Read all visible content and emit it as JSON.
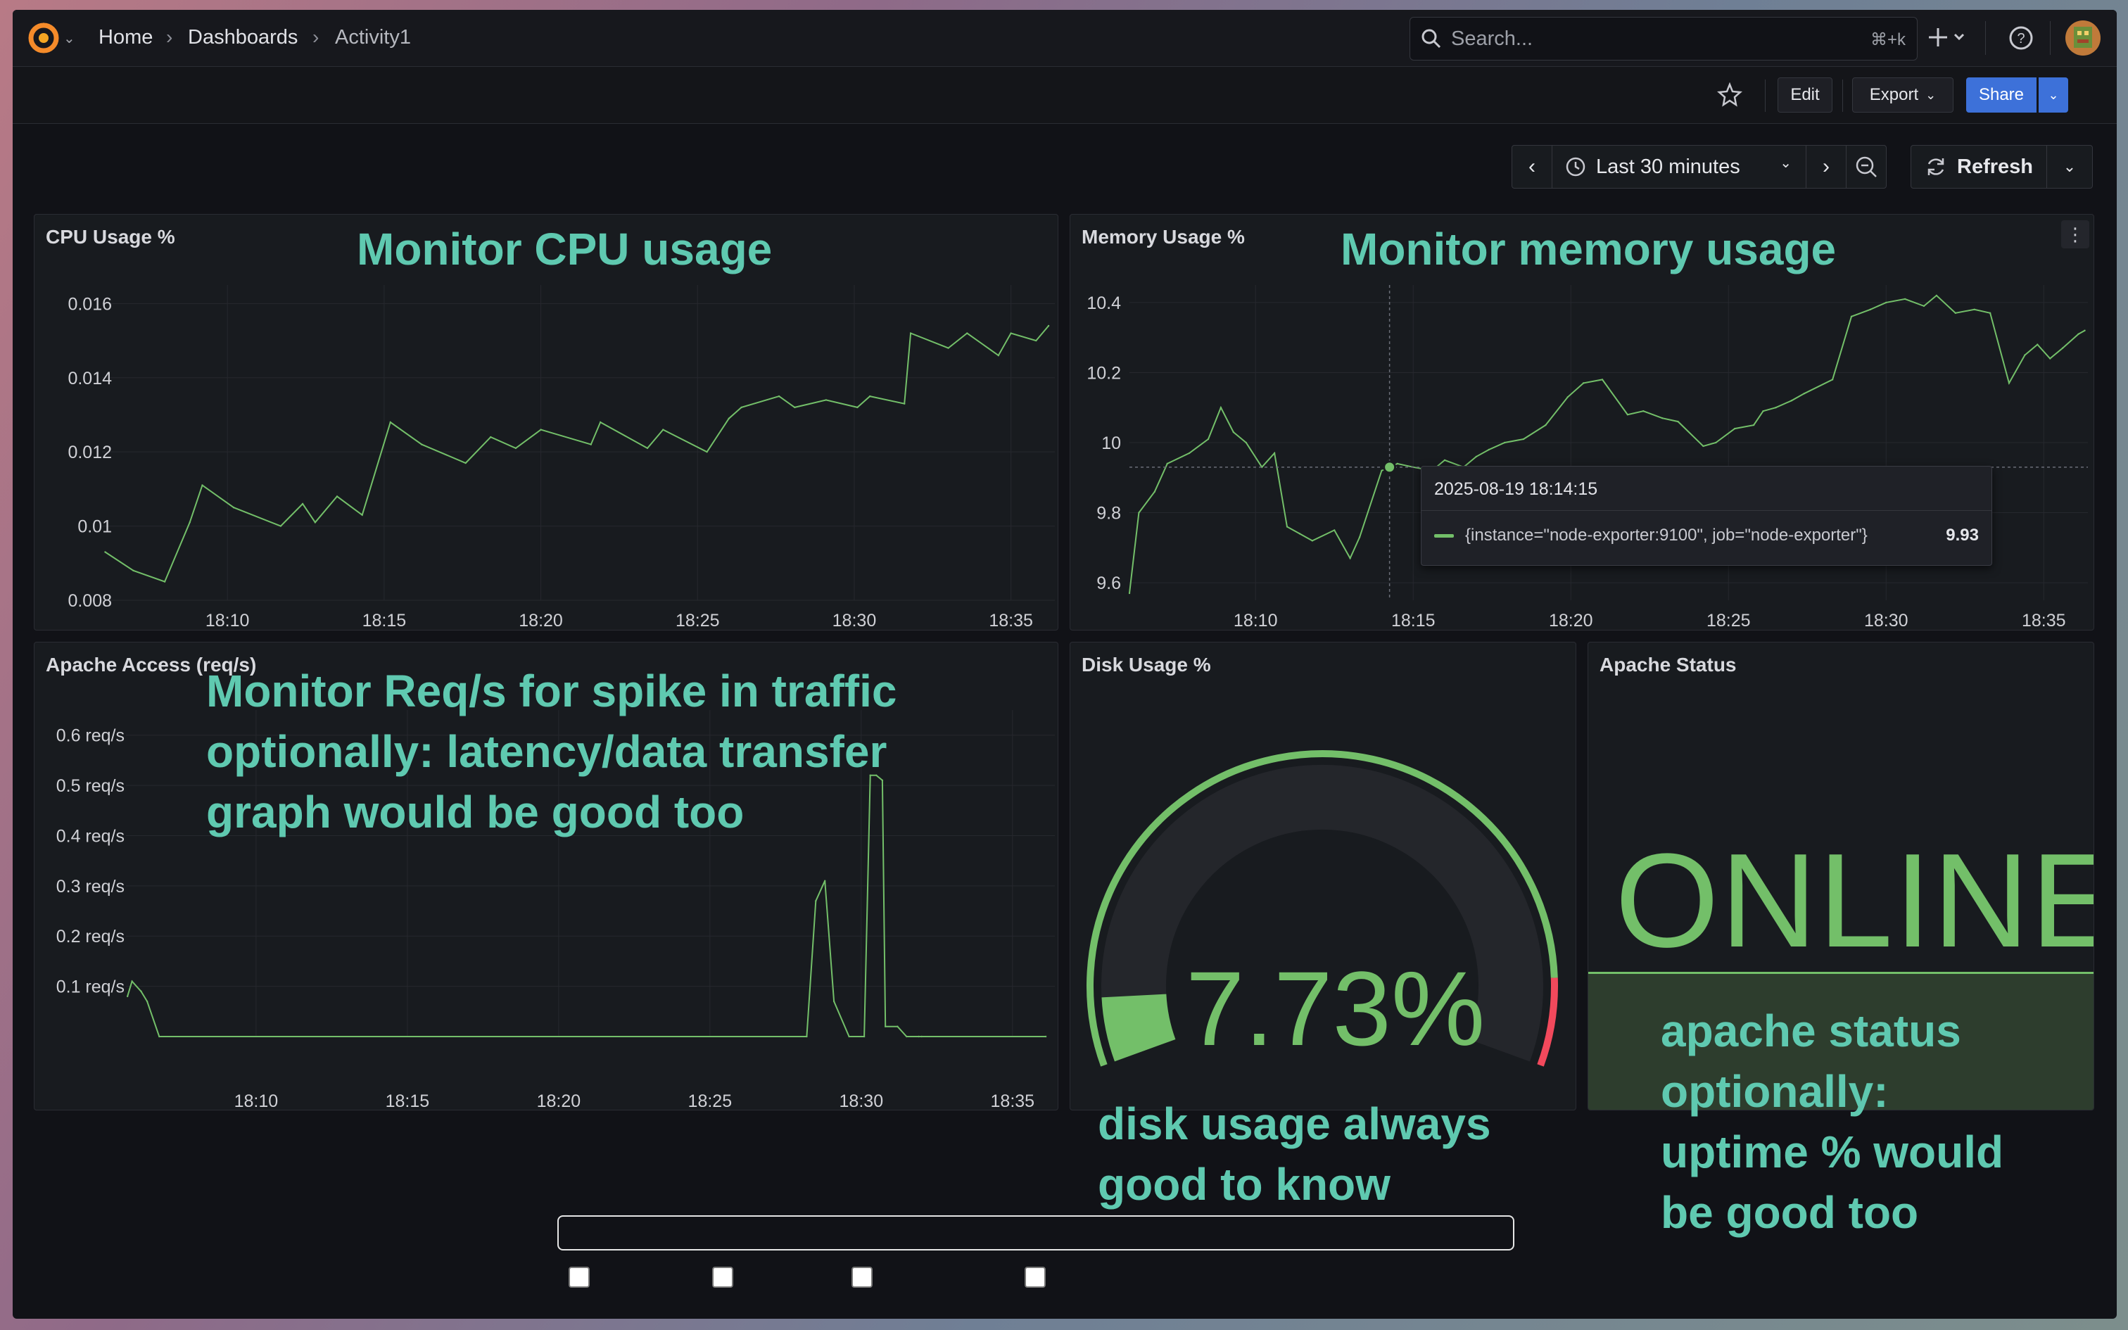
{
  "breadcrumb": {
    "home": "Home",
    "dashboards": "Dashboards",
    "current": "Activity1"
  },
  "search": {
    "placeholder": "Search...",
    "shortcut": "⌘+k"
  },
  "toolbar": {
    "edit": "Edit",
    "export": "Export",
    "share": "Share"
  },
  "time": {
    "range": "Last 30 minutes",
    "refresh": "Refresh"
  },
  "colors": {
    "accent": "#3d71d9",
    "series": "#73bf69",
    "threshold": "#f2495c",
    "annotation": "#5fc9b0"
  },
  "panels": {
    "cpu": {
      "title": "CPU Usage %",
      "annotation": "Monitor CPU usage",
      "chart_data": {
        "type": "line",
        "y_ticks": [
          "0.016",
          "0.014",
          "0.012",
          "0.01",
          "0.008"
        ],
        "x_ticks": [
          "18:10",
          "18:15",
          "18:20",
          "18:25",
          "18:30",
          "18:35"
        ],
        "ylim": [
          0.008,
          0.0165
        ],
        "xlim": [
          6.0,
          36.4
        ],
        "x": [
          6.1,
          7.0,
          8.0,
          8.8,
          9.2,
          10.2,
          11.7,
          12.4,
          12.8,
          13.5,
          14.3,
          15.2,
          16.2,
          17.6,
          18.4,
          19.2,
          20.0,
          21.6,
          21.9,
          23.4,
          23.9,
          25.3,
          26.0,
          26.4,
          27.6,
          28.1,
          29.1,
          30.1,
          30.5,
          31.6,
          31.8,
          33.0,
          33.6,
          34.6,
          35.0,
          35.8,
          36.2
        ],
        "y": [
          0.0093,
          0.0088,
          0.0085,
          0.0101,
          0.0111,
          0.0105,
          0.01,
          0.0106,
          0.0101,
          0.0108,
          0.0103,
          0.0128,
          0.0122,
          0.0117,
          0.0124,
          0.0121,
          0.0126,
          0.0122,
          0.0128,
          0.0121,
          0.0126,
          0.012,
          0.0129,
          0.0132,
          0.0135,
          0.0132,
          0.0134,
          0.0132,
          0.0135,
          0.0133,
          0.0152,
          0.0148,
          0.0152,
          0.0146,
          0.0152,
          0.015,
          0.0154
        ]
      }
    },
    "memory": {
      "title": "Memory Usage %",
      "annotation": "Monitor memory usage",
      "chart_data": {
        "type": "line",
        "y_ticks": [
          "10.4",
          "10.2",
          "10",
          "9.8",
          "9.6"
        ],
        "x_ticks": [
          "18:10",
          "18:15",
          "18:20",
          "18:25",
          "18:30",
          "18:35"
        ],
        "ylim": [
          9.55,
          10.45
        ],
        "xlim": [
          6.0,
          36.4
        ],
        "x": [
          6.0,
          6.3,
          6.8,
          7.2,
          7.9,
          8.5,
          8.9,
          9.3,
          9.7,
          10.2,
          10.6,
          11.0,
          11.4,
          11.8,
          12.5,
          13.0,
          13.3,
          14.0,
          14.5,
          15.0,
          15.6,
          16.0,
          16.6,
          17.0,
          17.4,
          17.9,
          18.5,
          19.2,
          19.9,
          20.4,
          21.0,
          21.8,
          22.3,
          22.9,
          23.4,
          24.2,
          24.6,
          25.2,
          25.8,
          26.1,
          26.5,
          27.0,
          27.4,
          28.3,
          28.9,
          29.5,
          30.0,
          30.6,
          31.2,
          31.6,
          32.2,
          32.8,
          33.3,
          33.9,
          34.4,
          34.8,
          35.2,
          35.6,
          36.1,
          36.3
        ],
        "y": [
          9.57,
          9.8,
          9.86,
          9.94,
          9.97,
          10.01,
          10.1,
          10.03,
          10.0,
          9.93,
          9.97,
          9.76,
          9.74,
          9.72,
          9.75,
          9.67,
          9.73,
          9.92,
          9.94,
          9.93,
          9.92,
          9.95,
          9.93,
          9.96,
          9.98,
          10.0,
          10.01,
          10.05,
          10.13,
          10.17,
          10.18,
          10.08,
          10.09,
          10.07,
          10.06,
          9.99,
          10.0,
          10.04,
          10.05,
          10.09,
          10.1,
          10.12,
          10.14,
          10.18,
          10.36,
          10.38,
          10.4,
          10.41,
          10.39,
          10.42,
          10.37,
          10.38,
          10.37,
          10.17,
          10.25,
          10.28,
          10.24,
          10.27,
          10.31,
          10.32
        ],
        "tooltip": {
          "time": "2025-08-19 18:14:15",
          "label": "{instance=\"node-exporter:9100\", job=\"node-exporter\"}",
          "value": "9.93",
          "x": 14.25,
          "y": 9.93
        }
      }
    },
    "apache_access": {
      "title": "Apache Access (req/s)",
      "annotation": "Monitor Req/s for spike in traffic\noptionally: latency/data transfer\ngraph would be good too",
      "chart_data": {
        "type": "line",
        "y_ticks": [
          "0.6 req/s",
          "0.5 req/s",
          "0.4 req/s",
          "0.3 req/s",
          "0.2 req/s",
          "0.1 req/s"
        ],
        "x_ticks": [
          "18:10",
          "18:15",
          "18:20",
          "18:25",
          "18:30",
          "18:35"
        ],
        "ylim": [
          0.0,
          0.65
        ],
        "xlim": [
          5.7,
          36.4
        ],
        "x": [
          5.75,
          5.9,
          6.2,
          6.4,
          6.8,
          28.2,
          28.5,
          28.8,
          29.1,
          29.6,
          30.1,
          30.3,
          30.5,
          30.7,
          30.8,
          31.2,
          31.5,
          31.9,
          32.0,
          36.1
        ],
        "y": [
          0.08,
          0.11,
          0.09,
          0.07,
          0.0,
          0.0,
          0.27,
          0.31,
          0.07,
          0.0,
          0.0,
          0.52,
          0.52,
          0.51,
          0.02,
          0.02,
          0.0,
          0.0,
          0.0,
          0.0
        ]
      }
    },
    "disk": {
      "title": "Disk Usage %",
      "value": "7.73%",
      "value_number": 7.73,
      "annotation": "disk usage always\ngood to know"
    },
    "apache_status": {
      "title": "Apache Status",
      "status": "ONLINE",
      "annotation": "apache status\noptionally:\nuptime % would\nbe good too"
    }
  }
}
